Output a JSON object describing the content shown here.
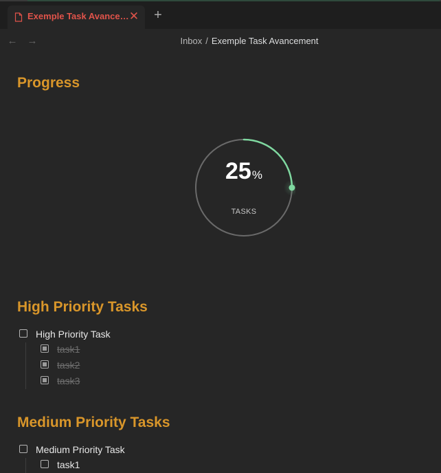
{
  "tab": {
    "title": "Exemple Task Avancement",
    "new_tab_symbol": "+"
  },
  "nav": {
    "back_symbol": "←",
    "forward_symbol": "→"
  },
  "breadcrumb": {
    "parent": "Inbox",
    "separator": "/",
    "current": "Exemple Task Avancement"
  },
  "progress": {
    "heading": "Progress",
    "value": "25",
    "unit": "%",
    "label": "TASKS",
    "fraction": 0.25
  },
  "high_priority": {
    "heading": "High Priority Tasks",
    "parent_task": "High Priority Task",
    "subtasks": [
      "task1",
      "task2",
      "task3"
    ]
  },
  "medium_priority": {
    "heading": "Medium Priority Tasks",
    "parent_task": "Medium Priority Task",
    "subtasks": [
      "task1"
    ]
  },
  "colors": {
    "heading": "#d9962a",
    "tab_active": "#e0534a",
    "progress_accent": "#7fd8a0",
    "background": "#262626"
  }
}
